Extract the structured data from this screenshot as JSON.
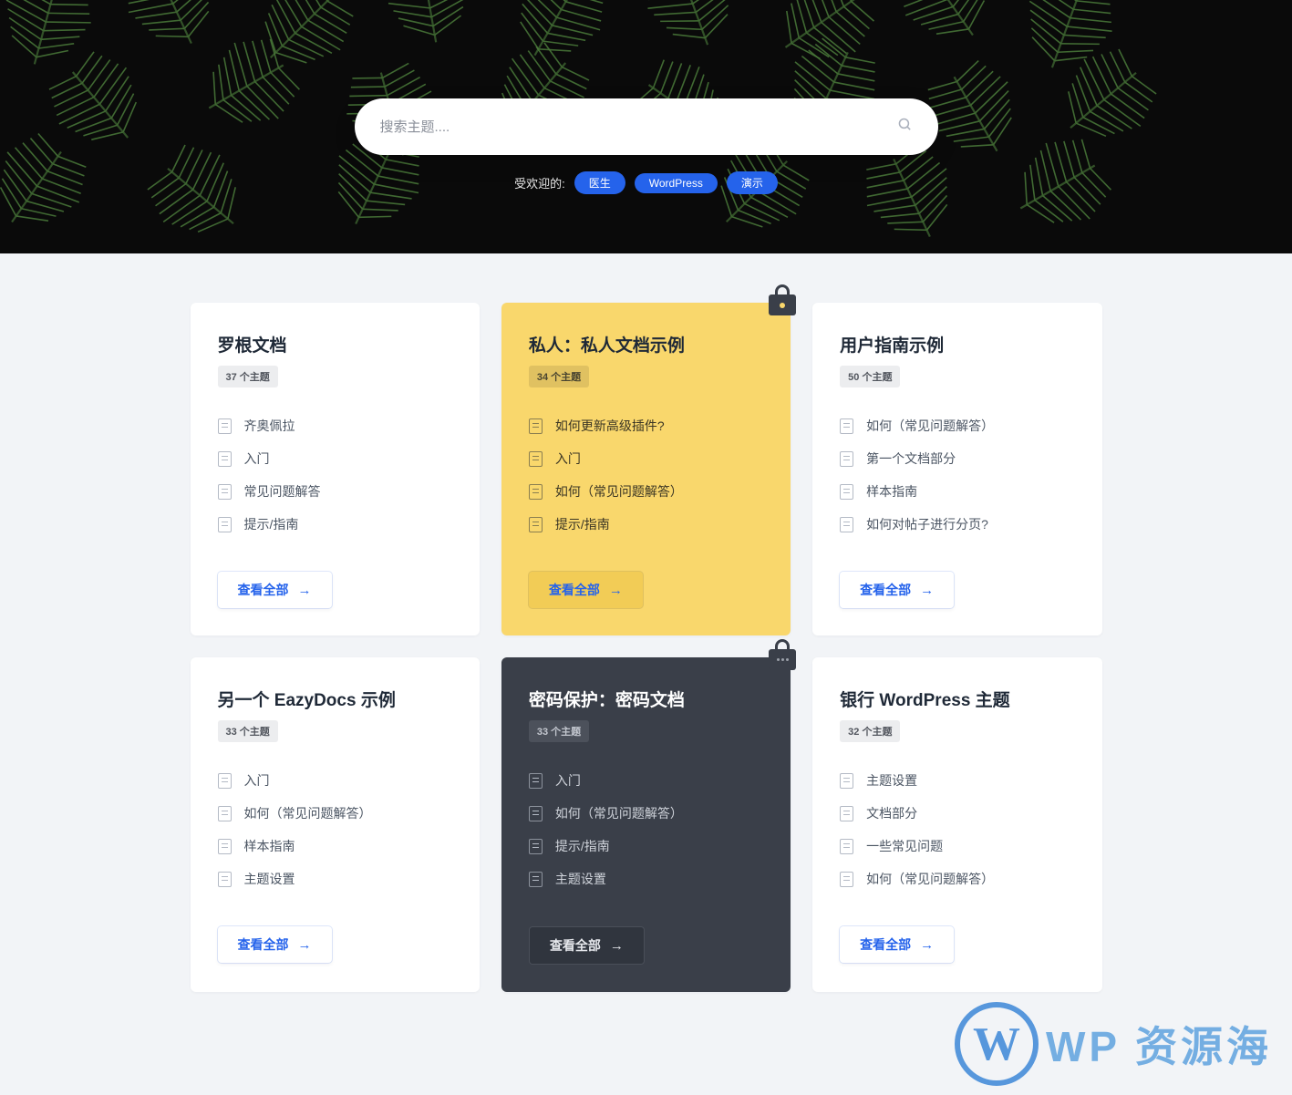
{
  "search": {
    "placeholder": "搜索主题...."
  },
  "popular": {
    "label": "受欢迎的:",
    "tags": [
      "医生",
      "WordPress",
      "演示"
    ]
  },
  "view_all_label": "查看全部",
  "cards": [
    {
      "title": "罗根文档",
      "count_label": "37 个主题",
      "variant": "light",
      "locked": false,
      "topics": [
        "齐奥佩拉",
        "入门",
        "常见问题解答",
        "提示/指南"
      ]
    },
    {
      "title": "私人：私人文档示例",
      "count_label": "34 个主题",
      "variant": "yellow",
      "locked": "key",
      "topics": [
        "如何更新高级插件?",
        "入门",
        "如何（常见问题解答）",
        "提示/指南"
      ]
    },
    {
      "title": "用户指南示例",
      "count_label": "50 个主题",
      "variant": "light",
      "locked": false,
      "topics": [
        "如何（常见问题解答）",
        "第一个文档部分",
        "样本指南",
        "如何对帖子进行分页?"
      ]
    },
    {
      "title": "另一个 EazyDocs 示例",
      "count_label": "33 个主题",
      "variant": "light",
      "locked": false,
      "topics": [
        "入门",
        "如何（常见问题解答）",
        "样本指南",
        "主题设置"
      ]
    },
    {
      "title": "密码保护：密码文档",
      "count_label": "33 个主题",
      "variant": "dark",
      "locked": "dots",
      "topics": [
        "入门",
        "如何（常见问题解答）",
        "提示/指南",
        "主题设置"
      ]
    },
    {
      "title": "银行 WordPress 主题",
      "count_label": "32 个主题",
      "variant": "light",
      "locked": false,
      "topics": [
        "主题设置",
        "文档部分",
        "一些常见问题",
        "如何（常见问题解答）"
      ]
    }
  ],
  "watermark": {
    "letter": "W",
    "text": "WP 资源海"
  }
}
